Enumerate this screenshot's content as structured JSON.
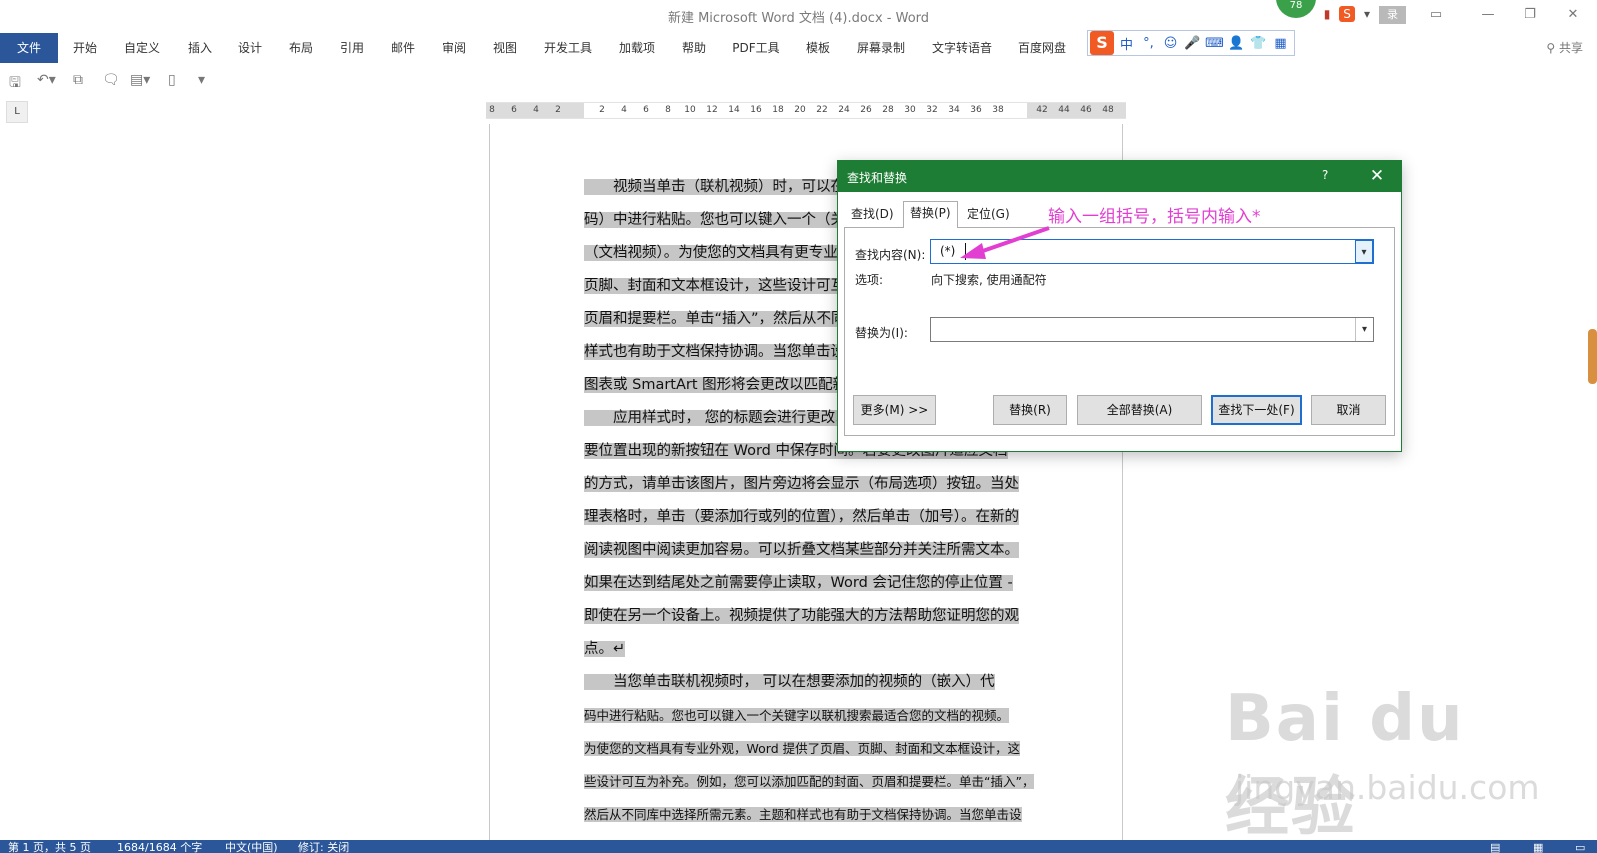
{
  "window": {
    "title": "新建 Microsoft Word 文档 (4).docx  -  Word",
    "badge": "78",
    "login_label": "录"
  },
  "ribbon": {
    "tabs": [
      "文件",
      "开始",
      "自定义",
      "插入",
      "设计",
      "布局",
      "引用",
      "邮件",
      "审阅",
      "视图",
      "开发工具",
      "加载项",
      "帮助",
      "PDF工具",
      "模板",
      "屏幕录制",
      "文字转语音",
      "百度网盘"
    ],
    "share_label": "共享"
  },
  "ime": {
    "logo": "S",
    "items": [
      "中",
      "°,",
      "☺",
      "🎤",
      "⌨",
      "👤",
      "👕",
      "▦"
    ]
  },
  "ruler": {
    "ticks": [
      "8",
      "6",
      "4",
      "2",
      "",
      "2",
      "4",
      "6",
      "8",
      "10",
      "12",
      "14",
      "16",
      "18",
      "20",
      "22",
      "24",
      "26",
      "28",
      "30",
      "32",
      "34",
      "36",
      "38",
      "",
      "42",
      "44",
      "46",
      "48"
    ]
  },
  "document": {
    "lines": [
      "　　视频当单击（联机视频）时，可以在想要添加的视频的（嵌入代",
      "码）中进行粘贴。您也可以键入一个（关键字）以联机搜索最适合您",
      "（文档视频）。为使您的文档具有更专业的外观，Word 提供了页眉、",
      "页脚、封面和文本框设计，这些设计可互为补充。例如，您可以添加",
      "页眉和提要栏。单击“插入”，然后从不同库中选择所需元素。主题和",
      "样式也有助于文档保持协调。当您单击设计并选择新的主题时，图片、",
      "图表或 SmartArt 图形将会更改以匹配新的主题。当",
      "　　应用样式时，  您的标题会进行更改以匹配新的主题。使用在需",
      "要位置出现的新按钮在 Word 中保存时间。若要更改图片适应文档",
      "的方式，请单击该图片，图片旁边将会显示（布局选项）按钮。当处",
      "理表格时，单击（要添加行或列的位置），然后单击（加号）。在新的",
      "阅读视图中阅读更加容易。可以折叠文档某些部分并关注所需文本。",
      "如果在达到结尾处之前需要停止读取，Word 会记住您的停止位置 - ",
      "即使在另一个设备上。视频提供了功能强大的方法帮助您证明您的观",
      "点。↵",
      "　　当您单击联机视频时，    可以在想要添加的视频的（嵌入）代",
      "码中进行粘贴。您也可以键入一个关键字以联机搜索最适合您的文档的视频。",
      "为使您的文档具有专业外观，Word 提供了页眉、页脚、封面和文本框设计，这",
      "些设计可互为补充。例如，您可以添加匹配的封面、页眉和提要栏。单击“插入”，",
      "然后从不同库中选择所需元素。主题和样式也有助于文档保持协调。当您单击设"
    ]
  },
  "dialog": {
    "title": "查找和替换",
    "help": "?",
    "close": "✕",
    "tabs": [
      "查找(D)",
      "替换(P)",
      "定位(G)"
    ],
    "find_label": "查找内容(N):",
    "find_value": "(*)",
    "options_label": "选项:",
    "options_value": "向下搜索, 使用通配符",
    "replace_label": "替换为(I):",
    "replace_value": "",
    "buttons": {
      "more": "更多(M) >>",
      "replace": "替换(R)",
      "replace_all": "全部替换(A)",
      "find_next": "查找下一处(F)",
      "cancel": "取消"
    }
  },
  "annotation": {
    "text": "输入一组括号，括号内输入*",
    "color": "#e23fd2"
  },
  "status": {
    "page": "第 1 页，共 5 页",
    "words": "1684/1684 个字",
    "lang": "中文(中国)",
    "track": "修订: 关闭"
  },
  "watermark": {
    "brand": "Bai du 经验",
    "url": "jingyan.baidu.com"
  },
  "colors": {
    "ribbon_blue": "#2b579a",
    "dialog_green": "#1e7d34",
    "selection": "#c6c6c6"
  }
}
